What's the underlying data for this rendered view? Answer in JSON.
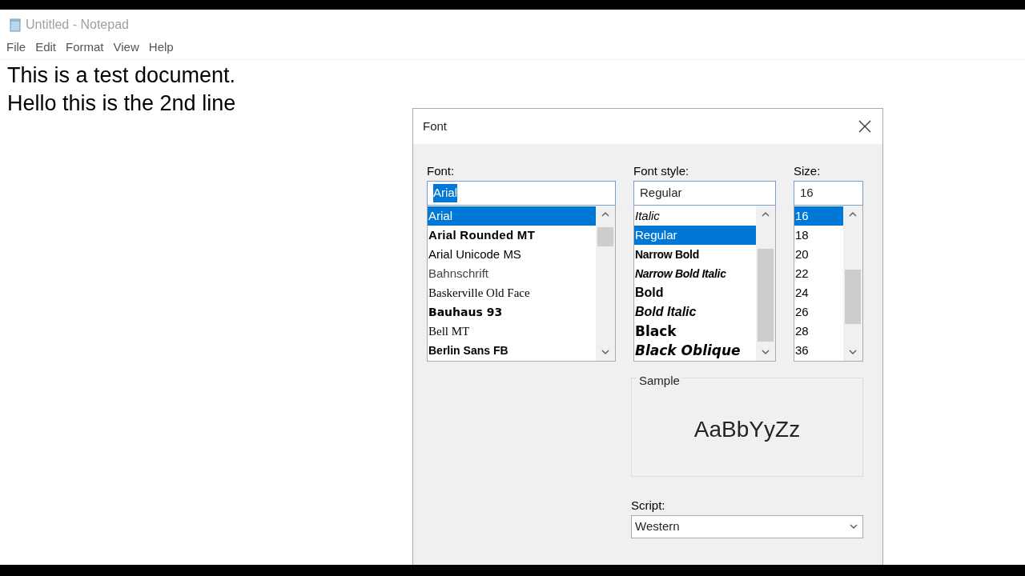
{
  "window": {
    "title": "Untitled - Notepad",
    "active": false
  },
  "menu": [
    {
      "label": "File"
    },
    {
      "label": "Edit"
    },
    {
      "label": "Format"
    },
    {
      "label": "View"
    },
    {
      "label": "Help"
    }
  ],
  "document": {
    "lines": [
      "This is a test document.",
      "Hello this is the 2nd line"
    ]
  },
  "dialog": {
    "title": "Font",
    "font": {
      "label": "Font:",
      "value": "Arial",
      "items": [
        {
          "label": "Arial",
          "kind": "sans",
          "selected": true
        },
        {
          "label": "Arial Rounded MT",
          "kind": "rounded",
          "selected": false
        },
        {
          "label": "Arial Unicode MS",
          "kind": "sans",
          "selected": false
        },
        {
          "label": "Bahnschrift",
          "kind": "light",
          "selected": false
        },
        {
          "label": "Baskerville Old Face",
          "kind": "serif",
          "selected": false
        },
        {
          "label": "Bauhaus 93",
          "kind": "display",
          "selected": false
        },
        {
          "label": "Bell MT",
          "kind": "serif",
          "selected": false
        },
        {
          "label": "Berlin Sans FB",
          "kind": "semibold",
          "selected": false
        }
      ]
    },
    "style": {
      "label": "Font style:",
      "value": "Regular",
      "items": [
        {
          "label": "Italic",
          "kind": "italic",
          "selected": false
        },
        {
          "label": "Regular",
          "kind": "regular",
          "selected": true
        },
        {
          "label": "Narrow Bold",
          "kind": "narrow-bold",
          "selected": false
        },
        {
          "label": "Narrow Bold Italic",
          "kind": "narrow-bold-italic",
          "selected": false
        },
        {
          "label": "Bold",
          "kind": "bold",
          "selected": false
        },
        {
          "label": "Bold Italic",
          "kind": "bold-italic",
          "selected": false
        },
        {
          "label": "Black",
          "kind": "black",
          "selected": false
        },
        {
          "label": "Black Oblique",
          "kind": "black-italic",
          "selected": false
        }
      ]
    },
    "size": {
      "label": "Size:",
      "value": "16",
      "items": [
        {
          "label": "16",
          "selected": true
        },
        {
          "label": "18",
          "selected": false
        },
        {
          "label": "20",
          "selected": false
        },
        {
          "label": "22",
          "selected": false
        },
        {
          "label": "24",
          "selected": false
        },
        {
          "label": "26",
          "selected": false
        },
        {
          "label": "28",
          "selected": false
        },
        {
          "label": "36",
          "selected": false
        }
      ]
    },
    "sample": {
      "label": "Sample",
      "text": "AaBbYyZz"
    },
    "script": {
      "label": "Script:",
      "value": "Western"
    }
  }
}
